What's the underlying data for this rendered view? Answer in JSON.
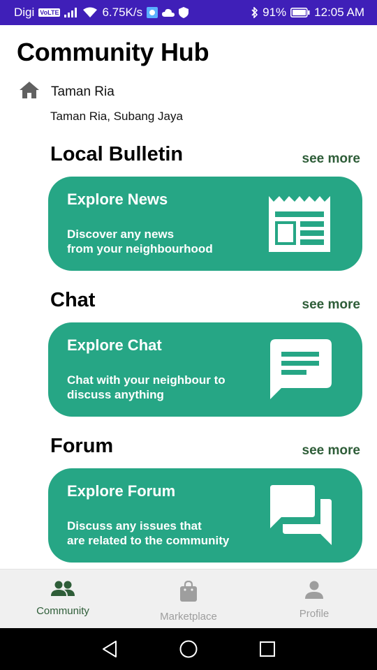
{
  "status_bar": {
    "carrier": "Digi",
    "volte_badge": "VoLTE",
    "speed": "6.75K/s",
    "battery": "91%",
    "time": "12:05 AM"
  },
  "header": {
    "title": "Community Hub",
    "location_name": "Taman Ria",
    "location_detail": "Taman Ria, Subang Jaya"
  },
  "sections": [
    {
      "title": "Local Bulletin",
      "see_more": "see more",
      "card_title": "Explore News",
      "card_desc": "Discover any news\nfrom your neighbourhood",
      "icon": "newspaper-icon"
    },
    {
      "title": "Chat",
      "see_more": "see more",
      "card_title": "Explore Chat",
      "card_desc": "Chat with your neighbour to\ndiscuss anything",
      "icon": "chat-bubble-icon"
    },
    {
      "title": "Forum",
      "see_more": "see more",
      "card_title": "Explore Forum",
      "card_desc": "Discuss any issues that\nare related to the community",
      "icon": "forum-icon"
    }
  ],
  "bottom_nav": {
    "items": [
      {
        "label": "Community",
        "icon": "people-icon",
        "active": true
      },
      {
        "label": "Marketplace",
        "icon": "shopping-bag-icon",
        "active": false
      },
      {
        "label": "Profile",
        "icon": "person-icon",
        "active": false
      }
    ]
  },
  "colors": {
    "status_bar": "#3f1fb8",
    "card": "#26a685",
    "accent_dark_green": "#2e5d38",
    "inactive": "#9e9e9e"
  }
}
